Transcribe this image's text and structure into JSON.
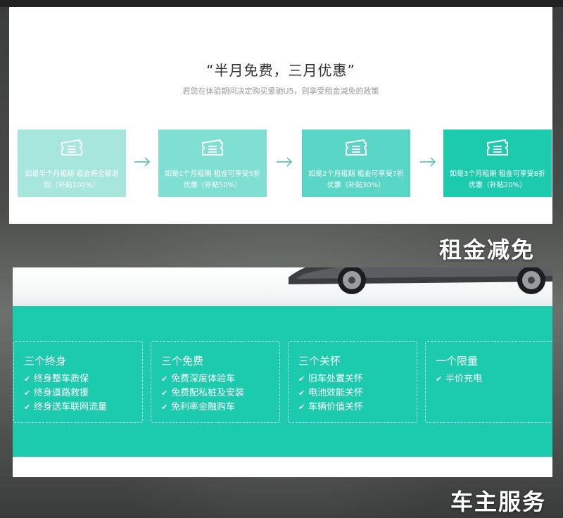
{
  "rent": {
    "title": "“半月免费，三月优惠”",
    "subtitle": "若您在体验期间决定购买爱驰U5，则享受租金减免的政策",
    "cards": [
      {
        "text": "如是半个月租期 租金将全额退回（补贴100%）",
        "color": "#a6e6dd"
      },
      {
        "text": "如是1个月租期 租金可享受5折优惠（补贴50%）",
        "color": "#7edfd2"
      },
      {
        "text": "如是2个月租期 租金可享受7折优惠（补贴30%）",
        "color": "#59d6c6"
      },
      {
        "text": "如是3个月租期 租金可享受8折优惠（补贴20%）",
        "color": "#1ccaae"
      }
    ],
    "label": "租金减免"
  },
  "owner": {
    "boxes": [
      {
        "title": "三个终身",
        "items": [
          "终身整车质保",
          "终身道路救援",
          "终身送车联网流量"
        ]
      },
      {
        "title": "三个免费",
        "items": [
          "免费深度体验车",
          "免费配私桩及安装",
          "免利率金融购车"
        ]
      },
      {
        "title": "三个关怀",
        "items": [
          "旧车处置关怀",
          "电池效能关怀",
          "车辆价值关怀"
        ]
      },
      {
        "title": "一个限量",
        "items": [
          "半价充电"
        ]
      }
    ],
    "label": "车主服务"
  },
  "icons": {
    "card": "ticket-icon",
    "arrow": "arrow-right-icon",
    "check": "check-icon"
  },
  "colors": {
    "accent": "#1ccaae"
  }
}
